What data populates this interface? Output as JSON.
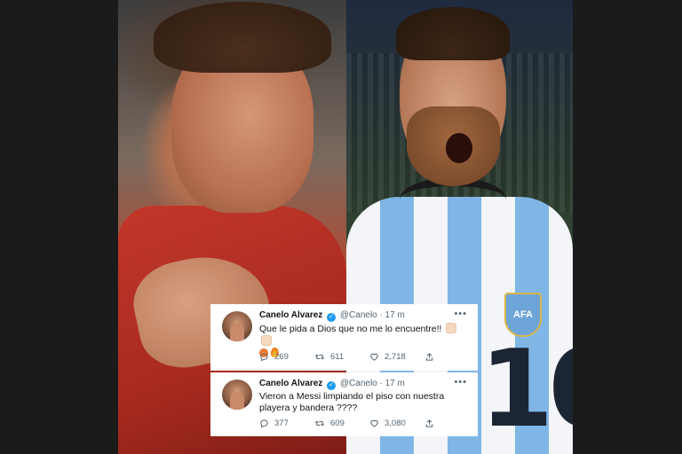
{
  "tweets": [
    {
      "name": "Canelo Alvarez",
      "handle": "@Canelo",
      "time": "· 17 m",
      "text": "Que le pida a Dios que no me lo encuentre!!",
      "emoji_line": [
        "hand-emoji",
        "hand-emoji",
        "angry-emoji",
        "fire-emoji"
      ],
      "replies": "269",
      "retweets": "611",
      "likes": "2,718"
    },
    {
      "name": "Canelo Alvarez",
      "handle": "@Canelo",
      "time": "· 17 m",
      "text": "Vieron a Messi limpiando el piso con nuestra playera y bandera ????",
      "replies": "377",
      "retweets": "609",
      "likes": "3,080"
    }
  ],
  "jersey_number": "10",
  "crest_text": "AFA",
  "colors": {
    "verified": "#1d9bf0",
    "muted": "#536471",
    "text": "#0f1419",
    "jersey_blue": "#7fb6e6"
  }
}
